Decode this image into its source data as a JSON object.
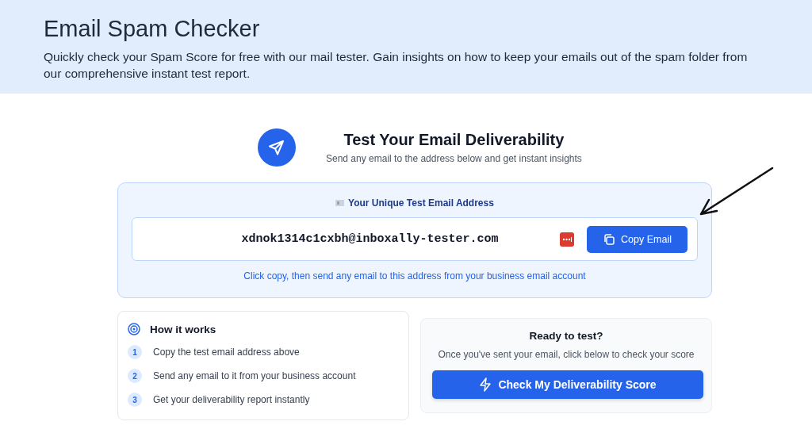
{
  "header": {
    "title": "Email Spam Checker",
    "description": "Quickly check your Spam Score for free with our mail tester. Gain insights on how to keep your emails out of the spam folder from our comprehensive instant test report."
  },
  "test": {
    "title": "Test Your Email Deliverability",
    "subtitle": "Send any email to the address below and get instant insights"
  },
  "address_card": {
    "label": "Your Unique Test Email Address",
    "email": "xdnok1314c1cxbh@inboxally-tester.com",
    "copy_button": "Copy Email",
    "hint": "Click copy, then send any email to this address from your business email account"
  },
  "how_it_works": {
    "title": "How it works",
    "steps": [
      {
        "number": "1",
        "text": "Copy the test email address above"
      },
      {
        "number": "2",
        "text": "Send any email to it from your business account"
      },
      {
        "number": "3",
        "text": "Get your deliverability report instantly"
      }
    ]
  },
  "ready": {
    "title": "Ready to test?",
    "text": "Once you've sent your email, click below to check your score",
    "button": "Check My Deliverability Score"
  }
}
